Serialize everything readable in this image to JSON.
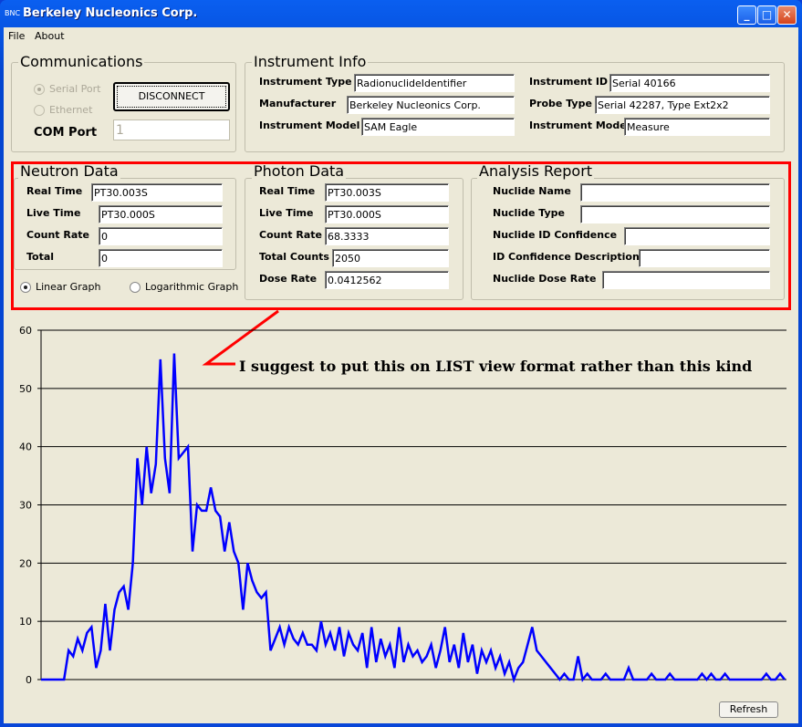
{
  "window": {
    "title": "Berkeley Nucleonics Corp.",
    "app_icon": "BNC",
    "buttons": {
      "minimize": "_",
      "maximize": "□",
      "close": "✕"
    }
  },
  "menu": [
    "File",
    "About"
  ],
  "communications": {
    "title": "Communications",
    "serial_port": "Serial Port",
    "ethernet": "Ethernet",
    "selected": "Serial Port",
    "disconnect": "DISCONNECT",
    "com_port_label": "COM Port",
    "com_port_value": "1"
  },
  "instrument_info": {
    "title": "Instrument Info",
    "instrument_type": {
      "label": "Instrument Type",
      "value": "RadionuclideIdentifier"
    },
    "manufacturer": {
      "label": "Manufacturer",
      "value": "Berkeley Nucleonics Corp."
    },
    "instrument_model": {
      "label": "Instrument Model",
      "value": "SAM Eagle"
    },
    "instrument_id": {
      "label": "Instrument ID",
      "value": "Serial 40166"
    },
    "probe_type": {
      "label": "Probe Type",
      "value": "Serial 42287, Type Ext2x2"
    },
    "instrument_mode": {
      "label": "Instrument Mode",
      "value": "Measure"
    }
  },
  "neutron": {
    "title": "Neutron Data",
    "real_time": {
      "label": "Real Time",
      "value": "PT30.003S"
    },
    "live_time": {
      "label": "Live Time",
      "value": "PT30.000S"
    },
    "count_rate": {
      "label": "Count Rate",
      "value": "0"
    },
    "total": {
      "label": "Total",
      "value": "0"
    }
  },
  "graph_mode": {
    "linear": "Linear Graph",
    "log": "Logarithmic Graph",
    "selected": "Linear Graph"
  },
  "photon": {
    "title": "Photon Data",
    "real_time": {
      "label": "Real Time",
      "value": "PT30.003S"
    },
    "live_time": {
      "label": "Live Time",
      "value": "PT30.000S"
    },
    "count_rate": {
      "label": "Count Rate",
      "value": "68.3333"
    },
    "total_counts": {
      "label": "Total Counts",
      "value": "2050"
    },
    "dose_rate": {
      "label": "Dose Rate",
      "value": "0.0412562"
    }
  },
  "analysis": {
    "title": "Analysis Report",
    "nuclide_name": {
      "label": "Nuclide Name",
      "value": ""
    },
    "nuclide_type": {
      "label": "Nuclide Type",
      "value": ""
    },
    "id_confidence": {
      "label": "Nuclide ID Confidence",
      "value": ""
    },
    "id_confidence_desc": {
      "label": "ID Confidence Description",
      "value": ""
    },
    "dose_rate": {
      "label": "Nuclide Dose Rate",
      "value": ""
    }
  },
  "annotation": {
    "text": "I suggest to put this on LIST view format rather than this kind",
    "color": "#ff0000"
  },
  "refresh": "Refresh",
  "chart_data": {
    "type": "line",
    "ylim": [
      0,
      60
    ],
    "yticks": [
      "0",
      "10",
      "20",
      "30",
      "40",
      "50",
      "60"
    ],
    "grid": true,
    "color": "#0000ff",
    "values": [
      0,
      0,
      0,
      0,
      0,
      0,
      5,
      4,
      7,
      5,
      8,
      9,
      2,
      5,
      13,
      5,
      12,
      15,
      16,
      12,
      20,
      38,
      30,
      40,
      32,
      37,
      55,
      38,
      32,
      56,
      38,
      39,
      40,
      22,
      30,
      29,
      29,
      33,
      29,
      28,
      22,
      27,
      22,
      20,
      12,
      20,
      17,
      15,
      14,
      15,
      5,
      7,
      9,
      6,
      9,
      7,
      6,
      8,
      6,
      6,
      5,
      10,
      6,
      8,
      5,
      9,
      4,
      8,
      6,
      5,
      8,
      2,
      9,
      3,
      7,
      4,
      6,
      2,
      9,
      3,
      6,
      4,
      5,
      3,
      4,
      6,
      2,
      5,
      9,
      3,
      6,
      2,
      8,
      3,
      6,
      1,
      5,
      3,
      5,
      2,
      4,
      1,
      3,
      0,
      2,
      3,
      6,
      9,
      5,
      4,
      3,
      2,
      1,
      0,
      1,
      0,
      0,
      4,
      0,
      1,
      0,
      0,
      0,
      1,
      0,
      0,
      0,
      0,
      2,
      0,
      0,
      0,
      0,
      1,
      0,
      0,
      0,
      1,
      0,
      0,
      0,
      0,
      0,
      0,
      1,
      0,
      1,
      0,
      0,
      1,
      0,
      0,
      0,
      0,
      0,
      0,
      0,
      0,
      1,
      0,
      0,
      1,
      0
    ]
  }
}
